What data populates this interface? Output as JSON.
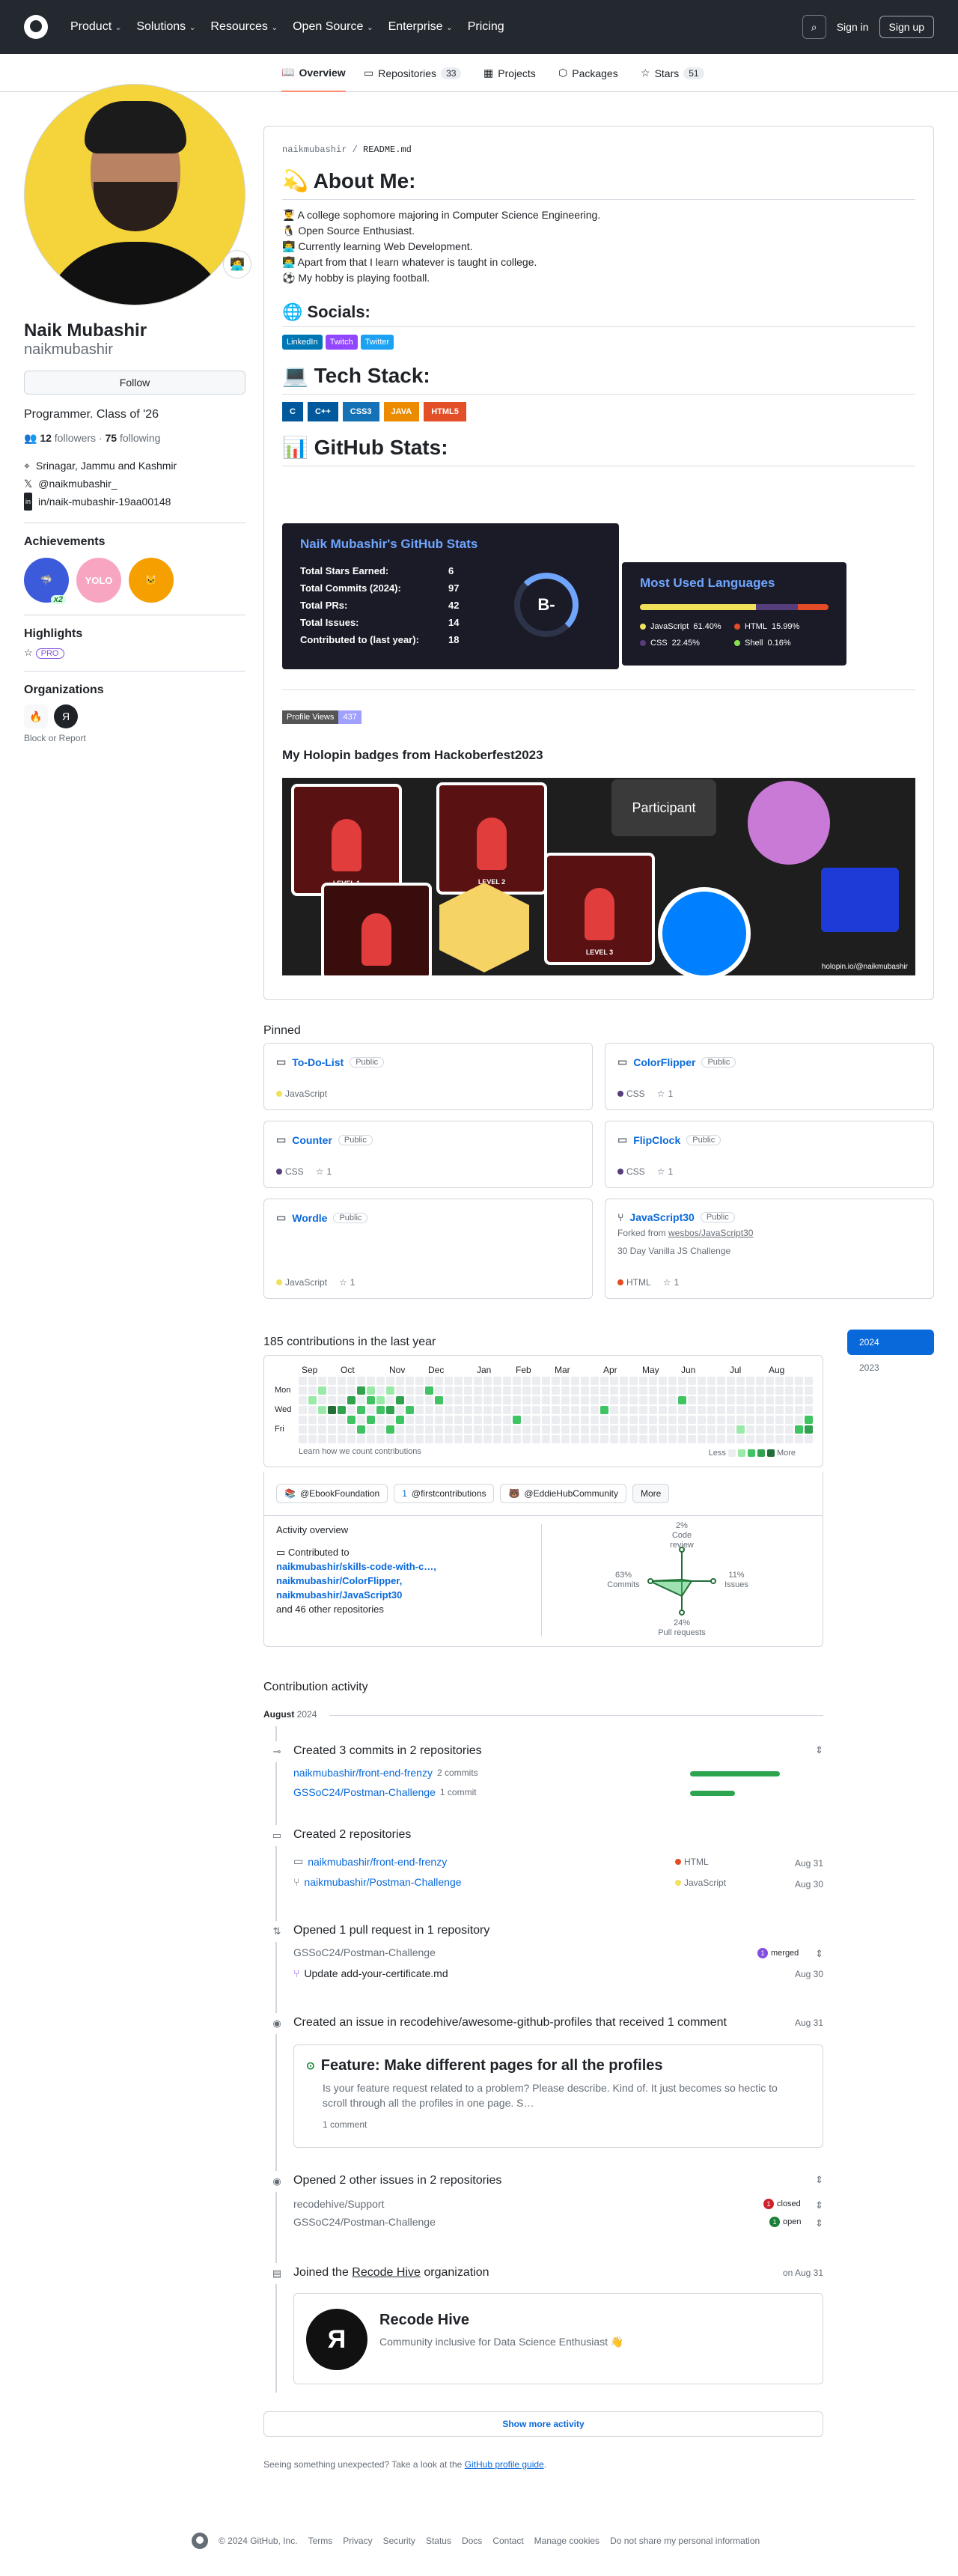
{
  "nav": {
    "items": [
      "Product",
      "Solutions",
      "Resources",
      "Open Source",
      "Enterprise",
      "Pricing"
    ],
    "signin": "Sign in",
    "signup": "Sign up"
  },
  "tabs": {
    "overview": "Overview",
    "repositories": "Repositories",
    "repositories_count": "33",
    "projects": "Projects",
    "packages": "Packages",
    "stars": "Stars",
    "stars_count": "51"
  },
  "profile": {
    "name": "Naik Mubashir",
    "login": "naikmubashir",
    "follow": "Follow",
    "bio": "Programmer. Class of '26",
    "followers": "12",
    "followers_label": "followers",
    "following": "75",
    "following_label": "following",
    "location": "Srinagar, Jammu and Kashmir",
    "twitter": "@naikmubashir_",
    "linkedin": "in/naik-mubashir-19aa00148",
    "achievements_title": "Achievements",
    "achievement_x2": "x2",
    "highlights_title": "Highlights",
    "highlight_pro": "PRO",
    "orgs_title": "Organizations",
    "block": "Block or Report"
  },
  "readme": {
    "path_user": "naikmubashir",
    "path_sep": " / ",
    "path_file": "README.md",
    "about_title": "💫 About Me:",
    "about_items": [
      "👨‍🎓 A college sophomore majoring in Computer Science Engineering.",
      "🐧 Open Source Enthusiast.",
      "👨‍💻 Currently learning Web Development.",
      "👨‍💻 Apart from that I learn whatever is taught in college.",
      "⚽ My hobby is playing football."
    ],
    "socials_title": "🌐 Socials:",
    "socials": [
      "LinkedIn",
      "Twitch",
      "Twitter"
    ],
    "tech_title": "💻 Tech Stack:",
    "tech": [
      "C",
      "C++",
      "CSS3",
      "JAVA",
      "HTML5"
    ],
    "stats_title": "📊 GitHub Stats:",
    "stats_card_title": "Naik Mubashir's GitHub Stats",
    "stats": [
      {
        "label": "Total Stars Earned:",
        "value": "6"
      },
      {
        "label": "Total Commits (2024):",
        "value": "97"
      },
      {
        "label": "Total PRs:",
        "value": "42"
      },
      {
        "label": "Total Issues:",
        "value": "14"
      },
      {
        "label": "Contributed to (last year):",
        "value": "18"
      }
    ],
    "grade": "B-",
    "langs_title": "Most Used Languages",
    "langs": [
      {
        "name": "JavaScript",
        "pct": "61.40%",
        "color": "#f1e05a",
        "value": 61.4
      },
      {
        "name": "HTML",
        "pct": "15.99%",
        "color": "#e34c26",
        "value": 15.99
      },
      {
        "name": "CSS",
        "pct": "22.45%",
        "color": "#563d7c",
        "value": 22.45
      },
      {
        "name": "Shell",
        "pct": "0.16%",
        "color": "#89e051",
        "value": 0.16
      }
    ],
    "views_label": "Profile Views",
    "views": "437",
    "holopin_title": "My Holopin badges from Hackoberfest2023",
    "holopin_levels": [
      "LEVEL 1",
      "LEVEL 2",
      "LEVEL 3"
    ],
    "holopin_participant": "Participant",
    "holopin_footer": "holopin.io/@naikmubashir"
  },
  "pinned": {
    "title": "Pinned",
    "public": "Public",
    "items": [
      {
        "name": "To-Do-List",
        "lang": "JavaScript",
        "color": "#f1e05a",
        "stars": ""
      },
      {
        "name": "ColorFlipper",
        "lang": "CSS",
        "color": "#563d7c",
        "stars": "1"
      },
      {
        "name": "Counter",
        "lang": "CSS",
        "color": "#563d7c",
        "stars": "1"
      },
      {
        "name": "FlipClock",
        "lang": "CSS",
        "color": "#563d7c",
        "stars": "1"
      },
      {
        "name": "Wordle",
        "lang": "JavaScript",
        "color": "#f1e05a",
        "stars": "1"
      },
      {
        "name": "JavaScript30",
        "lang": "HTML",
        "color": "#e34c26",
        "stars": "1",
        "forked_prefix": "Forked from ",
        "forked_from": "wesbos/JavaScript30",
        "desc": "30 Day Vanilla JS Challenge"
      }
    ]
  },
  "contrib": {
    "title": "185 contributions in the last year",
    "years": [
      "2024",
      "2023"
    ],
    "months": [
      "Sep",
      "Oct",
      "Nov",
      "Dec",
      "Jan",
      "Feb",
      "Mar",
      "Apr",
      "May",
      "Jun",
      "Jul",
      "Aug"
    ],
    "days": [
      "Mon",
      "Wed",
      "Fri"
    ],
    "learn": "Learn how we count contributions",
    "less": "Less",
    "more": "More",
    "orgs": [
      "@EbookFoundation",
      "@firstcontributions",
      "@EddieHubCommunity"
    ],
    "orgs_more": "More",
    "overview_title": "Activity overview",
    "contributed_prefix": "Contributed to",
    "contributed_repos": [
      "naikmubashir/skills-code-with-c…,",
      "naikmubashir/ColorFlipper,",
      "naikmubashir/JavaScript30"
    ],
    "contributed_suffix": "and 46 other repositories",
    "radar": {
      "code_review": "2%",
      "code_review_label": "Code review",
      "commits": "63%",
      "commits_label": "Commits",
      "issues": "11%",
      "issues_label": "Issues",
      "prs": "24%",
      "prs_label": "Pull requests"
    }
  },
  "activity": {
    "title": "Contribution activity",
    "month": "August",
    "year": "2024",
    "commits_title": "Created 3 commits in 2 repositories",
    "commits": [
      {
        "repo": "naikmubashir/front-end-frenzy",
        "count": "2 commits",
        "pct": 1.0
      },
      {
        "repo": "GSSoC24/Postman-Challenge",
        "count": "1 commit",
        "pct": 0.5
      }
    ],
    "repos_title": "Created 2 repositories",
    "repos": [
      {
        "repo": "naikmubashir/front-end-frenzy",
        "lang": "HTML",
        "color": "#e34c26",
        "date": "Aug 31"
      },
      {
        "repo": "naikmubashir/Postman-Challenge",
        "lang": "JavaScript",
        "color": "#f1e05a",
        "date": "Aug 30"
      }
    ],
    "pr_title": "Opened 1 pull request in 1 repository",
    "pr_repo": "GSSoC24/Postman-Challenge",
    "pr_state": "1",
    "pr_state_label": "merged",
    "pr_item": "Update add-your-certificate.md",
    "pr_date": "Aug 30",
    "issue_title": "Created an issue in recodehive/awesome-github-profiles that received 1 comment",
    "issue_date": "Aug 31",
    "issue_card_title": "Feature: Make different pages for all the profiles",
    "issue_body": "Is your feature request related to a problem? Please describe. Kind of. It just becomes so hectic to scroll through all the profiles in one page. S…",
    "issue_comments": "1 comment",
    "issues2_title": "Opened 2 other issues in 2 repositories",
    "issues2": [
      {
        "repo": "recodehive/Support",
        "n": "1",
        "state": "closed",
        "color": "#cf222e"
      },
      {
        "repo": "GSSoC24/Postman-Challenge",
        "n": "1",
        "state": "open",
        "color": "#1a7f37"
      }
    ],
    "joined_prefix": "Joined the",
    "joined_org": "Recode Hive",
    "joined_suffix": "organization",
    "joined_date": "on Aug 31",
    "org_name": "Recode Hive",
    "org_desc": "Community inclusive for Data Science Enthusiast 👋",
    "show_more": "Show more activity",
    "unexpected": "Seeing something unexpected? Take a look at the",
    "guide": "GitHub profile guide",
    "guide_end": "."
  },
  "footer": {
    "copyright": "© 2024 GitHub, Inc.",
    "links": [
      "Terms",
      "Privacy",
      "Security",
      "Status",
      "Docs",
      "Contact",
      "Manage cookies",
      "Do not share my personal information"
    ]
  },
  "colors": {
    "accent": "#0969da",
    "header_bg": "#24292f",
    "green": "#2da44e"
  }
}
